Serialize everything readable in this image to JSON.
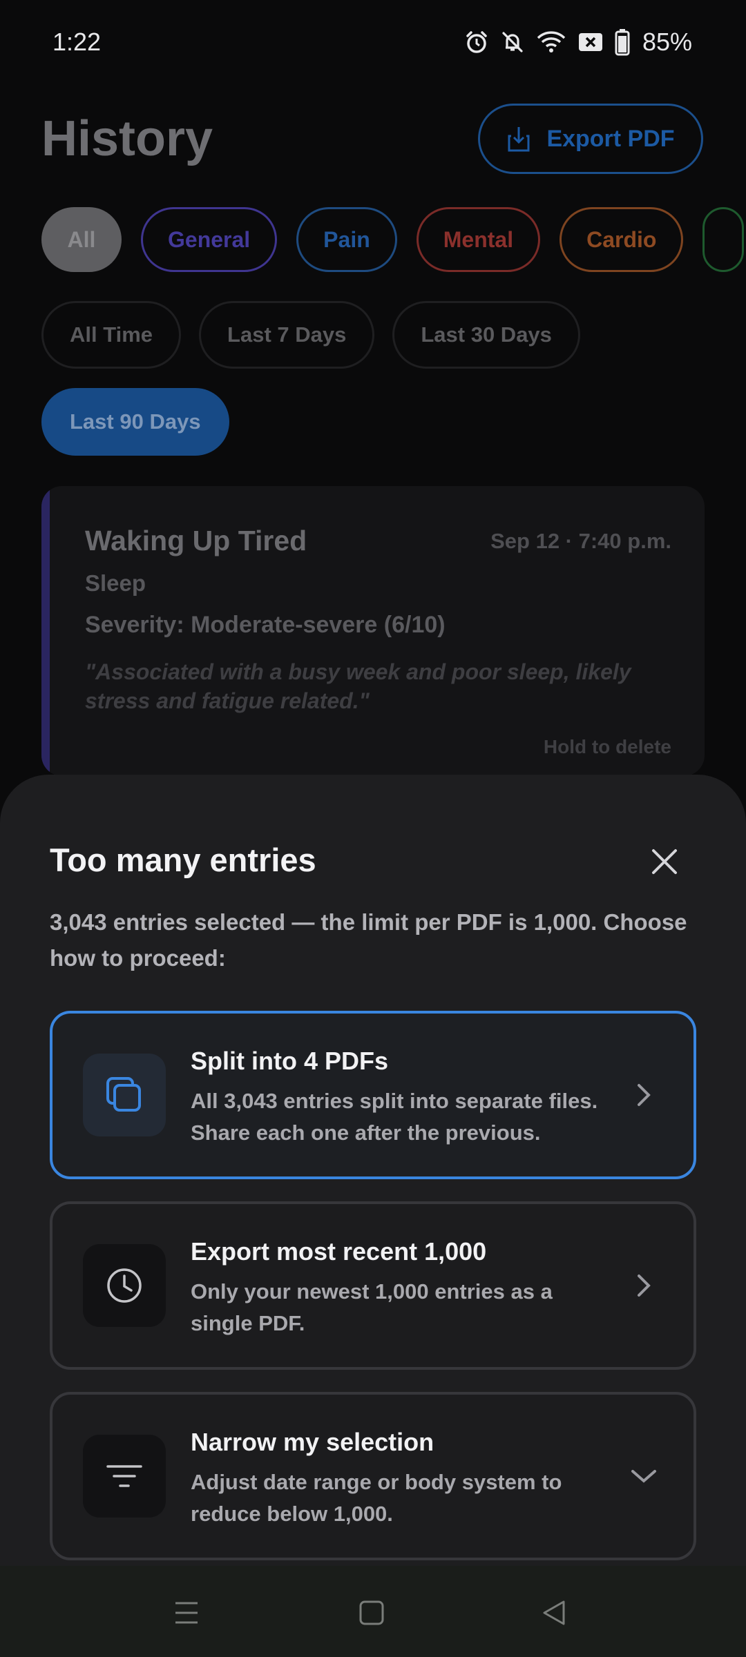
{
  "status_bar": {
    "time": "1:22",
    "battery_percent": "85%",
    "icons": [
      "alarm-icon",
      "mute-icon",
      "wifi-icon",
      "no-sim-icon",
      "battery-icon"
    ]
  },
  "history": {
    "title": "History",
    "export_button": "Export PDF",
    "filter_chips": [
      "All",
      "General",
      "Pain",
      "Mental",
      "Cardio"
    ],
    "range_chips": [
      "All Time",
      "Last 7 Days",
      "Last 30 Days",
      "Last 90 Days"
    ],
    "active_range": "Last 90 Days",
    "entry": {
      "title": "Waking Up Tired",
      "date": "Sep 12 · 7:40 p.m.",
      "category": "Sleep",
      "severity": "Severity: Moderate-severe (6/10)",
      "note": "\"Associated with a busy week and poor sleep, likely stress and fatigue related.\"",
      "hold_hint": "Hold to delete"
    }
  },
  "sheet": {
    "title": "Too many entries",
    "description": "3,043 entries selected — the limit per PDF is 1,000. Choose how to proceed:",
    "options": [
      {
        "title": "Split into 4 PDFs",
        "description": "All 3,043 entries split into separate files. Share each one after the previous.",
        "icon": "copy-icon",
        "selected": true
      },
      {
        "title": "Export most recent 1,000",
        "description": "Only your newest 1,000 entries as a single PDF.",
        "icon": "clock-icon",
        "selected": false
      },
      {
        "title": "Narrow my selection",
        "description": "Adjust date range or body system to reduce below 1,000.",
        "icon": "filter-icon",
        "selected": false
      }
    ]
  },
  "colors": {
    "accent": "#3a86e0",
    "sheet_bg": "#1e1e20",
    "general": "#43399a",
    "pain": "#21569a",
    "mental": "#8b302c",
    "cardio": "#8e4a22"
  }
}
